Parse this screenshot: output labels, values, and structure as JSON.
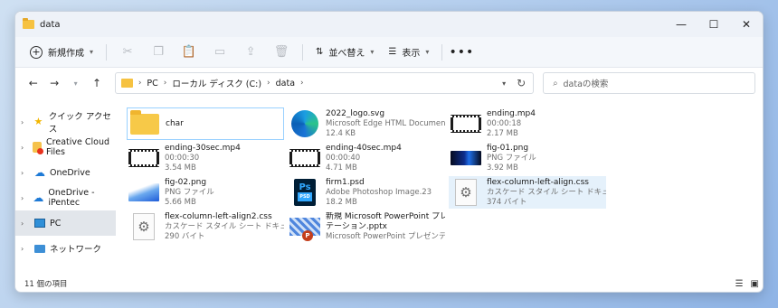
{
  "window": {
    "title": "data"
  },
  "window_controls": {
    "minimize": "—",
    "maximize": "☐",
    "close": "✕"
  },
  "toolbar": {
    "new_label": "新規作成",
    "sort_label": "並べ替え",
    "view_label": "表示",
    "more_label": "•••"
  },
  "address": {
    "crumbs": [
      "PC",
      "ローカル ディスク (C:)",
      "data"
    ],
    "search_placeholder": "dataの検索"
  },
  "sidebar": {
    "items": [
      {
        "label": "クイック アクセス"
      },
      {
        "label": "Creative Cloud Files"
      },
      {
        "label": "OneDrive"
      },
      {
        "label": "OneDrive - iPentec"
      },
      {
        "label": "PC"
      },
      {
        "label": "ネットワーク"
      }
    ]
  },
  "files": [
    {
      "name": "char",
      "line2": "",
      "line3": ""
    },
    {
      "name": "2022_logo.svg",
      "line2": "Microsoft Edge HTML Document",
      "line3": "12.4 KB"
    },
    {
      "name": "ending.mp4",
      "line2": "00:00:18",
      "line3": "2.17 MB"
    },
    {
      "name": "ending-30sec.mp4",
      "line2": "00:00:30",
      "line3": "3.54 MB"
    },
    {
      "name": "ending-40sec.mp4",
      "line2": "00:00:40",
      "line3": "4.71 MB"
    },
    {
      "name": "fig-01.png",
      "line2": "PNG ファイル",
      "line3": "3.92 MB"
    },
    {
      "name": "fig-02.png",
      "line2": "PNG ファイル",
      "line3": "5.66 MB"
    },
    {
      "name": "firm1.psd",
      "line2": "Adobe Photoshop Image.23",
      "line3": "18.2 MB"
    },
    {
      "name": "flex-column-left-align.css",
      "line2": "カスケード スタイル シート ドキュメント",
      "line3": "374 バイト"
    },
    {
      "name": "flex-column-left-align2.css",
      "line2": "カスケード スタイル シート ドキュメント",
      "line3": "290 バイト"
    },
    {
      "name": "新規 Microsoft PowerPoint プレゼン",
      "line2": "テーション.pptx",
      "line3": "Microsoft PowerPoint プレゼンテー..."
    }
  ],
  "status": {
    "item_count": "11 個の項目"
  },
  "colors": {
    "accent": "#0067c0",
    "selection": "#e5f1fb",
    "folder": "#f7c948"
  }
}
